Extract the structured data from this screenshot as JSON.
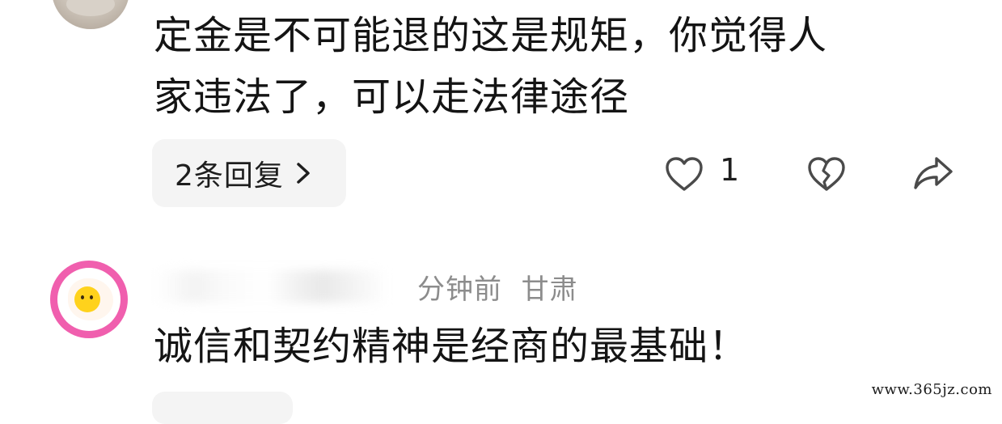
{
  "comments": [
    {
      "text_lines": [
        "定金是不可能退的这是规矩，你觉得人",
        "家违法了，可以走法律途径"
      ],
      "reply_pill": {
        "label": "2条回复"
      },
      "actions": {
        "like_count": "1",
        "like_icon": "heart-outline-icon",
        "dislike_icon": "broken-heart-icon",
        "share_icon": "share-arrow-icon"
      }
    },
    {
      "meta": {
        "time_location": "分钟前  甘肃"
      },
      "text_lines": [
        "诚信和契约精神是经商的最基础！"
      ]
    }
  ],
  "watermark": "www.365jz.com",
  "colors": {
    "text": "#141414",
    "meta": "#8c8c8c",
    "pill_bg": "#f4f4f4",
    "avatar_ring": "#f05fae",
    "yolk": "#ffd21c"
  }
}
